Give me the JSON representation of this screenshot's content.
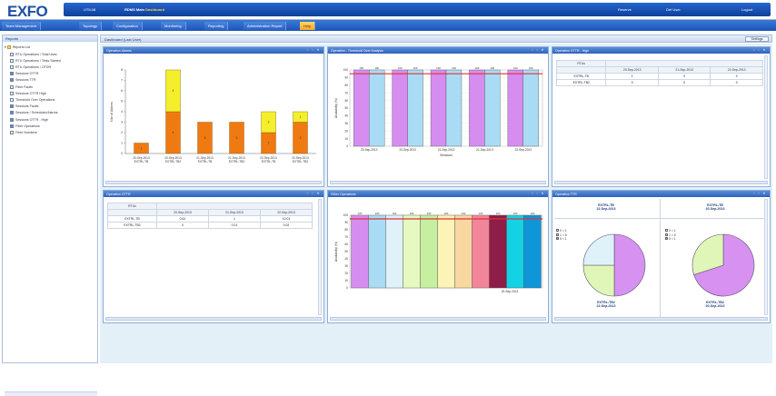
{
  "header": {
    "logo": "EXFO",
    "site": "UTIL08",
    "app_name": "RDMS Main",
    "app_sub": "Dashboard",
    "right_a": "Reserve",
    "right_b": "Def User",
    "logout": "Logout"
  },
  "tabs": [
    {
      "label": "Team Management",
      "active": false
    },
    {
      "label": "Topology",
      "active": false
    },
    {
      "label": "Configuration",
      "active": false
    },
    {
      "label": "Monitoring",
      "active": false
    },
    {
      "label": "Reporting",
      "active": false
    },
    {
      "label": "Administration Report",
      "active": false
    },
    {
      "label": "Help",
      "active": true
    }
  ],
  "left_panel": {
    "title": "Reports",
    "root": "Reports List",
    "items": [
      {
        "label": "RTU Operations / Total Uses",
        "checked": false
      },
      {
        "label": "RTU Operations / Tests Started",
        "checked": false
      },
      {
        "label": "RTU Operations / OTDR",
        "checked": false
      },
      {
        "label": "Sessions OTTR",
        "checked": true
      },
      {
        "label": "Sessions TTR",
        "checked": true
      },
      {
        "label": "Fiber Faults",
        "checked": false
      },
      {
        "label": "Sessions OTTR High",
        "checked": false
      },
      {
        "label": "Threshold Over Operations",
        "checked": false
      },
      {
        "label": "Sessions Faults",
        "checked": true
      },
      {
        "label": "Sessions / Scheduled Alarms",
        "checked": true
      },
      {
        "label": "Sessions OTTR - High",
        "checked": true
      },
      {
        "label": "Fiber Operations",
        "checked": true
      },
      {
        "label": "Fiber Numbers",
        "checked": false
      }
    ]
  },
  "dashboard": {
    "title": "Dashboard (Last User)",
    "settings_label": "Settings"
  },
  "panels": {
    "p1": {
      "title": "Operation Alarms"
    },
    "p2": {
      "title": "Operation - Threshold Over Analysis"
    },
    "p3": {
      "title": "Operation OTTR - High"
    },
    "p4": {
      "title": "Operation OTTR"
    },
    "p5": {
      "title": "Other Operations"
    },
    "p6": {
      "title": "Operation TTR"
    }
  },
  "table_ottr_high": {
    "col_label": "RTUs",
    "headers": [
      "",
      "20-Sep-2013",
      "21-Sep-2013",
      "22-Sep-2013"
    ],
    "rows": [
      [
        "EXTRL-TB",
        "1",
        "0",
        "0"
      ],
      [
        "EXTRL-TB2",
        "0",
        "0",
        "0"
      ]
    ]
  },
  "table_ottr": {
    "col_label": "RTUs",
    "headers": [
      "",
      "20-Sep-2013",
      "21-Sep-2013",
      "22-Sep-2013"
    ],
    "rows": [
      [
        "EXTRL-TB",
        "0.61",
        "1",
        "10.01"
      ],
      [
        "EXTRL-TB2",
        "0",
        "0.01",
        "0.02"
      ]
    ]
  },
  "pies": [
    {
      "top_label_1": "EXTRL-TB",
      "top_label_2": "22-Sep-2013",
      "bottom_label_1": "EXTRL-TB2",
      "bottom_label_2": "22-Sep-2013"
    },
    {
      "top_label_1": "EXTRL-TB",
      "top_label_2": "20-Sep-2013",
      "bottom_label_1": "EXTRL-TB2",
      "bottom_label_2": "20-Sep-2013"
    }
  ],
  "pie_legend": [
    "0 < 1",
    "1 < 5",
    "5 < 1"
  ],
  "colors": {
    "accent": "#2d62bd",
    "tab_active": "#f4a52a",
    "bar_orange": "#f07a12",
    "bar_yellow": "#f4ef2c",
    "threshold_line": "#e0303a",
    "bar_purple": "#d68df0",
    "bar_blue": "#a9dcf4",
    "pie_purple": "#d791f0",
    "pie_green": "#dff6b8",
    "pie_lightblue": "#dff2fa"
  },
  "chart_data": [
    {
      "type": "bar",
      "name": "Operation Alarms",
      "categories": [
        "20-Sep-2013 EXTRL-TB",
        "20-Sep-2013 EXTRL-TB2",
        "21-Sep-2013 EXTRL-TB",
        "21-Sep-2013 EXTRL-TB2",
        "22-Sep-2013 EXTRL-TB",
        "22-Sep-2013 EXTRL-TB2"
      ],
      "series": [
        {
          "values": [
            1,
            4,
            3,
            3,
            2,
            3
          ],
          "color": "#f07a12"
        },
        {
          "values": [
            0,
            4,
            0,
            0,
            2,
            1
          ],
          "color": "#f4ef2c"
        }
      ],
      "ylabel": "Nbr of Alarms",
      "ylim": [
        0,
        8
      ]
    },
    {
      "type": "bar",
      "name": "Operation - Threshold Over Analysis",
      "categories": [
        "20-Sep-2013",
        "20-Sep-2013",
        "21-Sep-2013",
        "21-Sep-2013",
        "22-Sep-2013"
      ],
      "series": [
        {
          "values": [
            100,
            100,
            100,
            100,
            100
          ],
          "color": "#d68df0"
        },
        {
          "values": [
            100,
            100,
            100,
            100,
            100
          ],
          "color": "#a9dcf4"
        }
      ],
      "threshold": 95,
      "ylabel": "Availability (%)",
      "xlabel": "Sessions",
      "ylim": [
        0,
        100
      ]
    },
    {
      "type": "bar",
      "name": "Other Operations",
      "categories": [
        "20-Sep-2013"
      ],
      "series": [
        {
          "values": [
            100
          ],
          "color": "#d68df0"
        },
        {
          "values": [
            100
          ],
          "color": "#a9dcf4"
        },
        {
          "values": [
            100
          ],
          "color": "#dff2fa"
        },
        {
          "values": [
            100
          ],
          "color": "#e6f9c0"
        },
        {
          "values": [
            100
          ],
          "color": "#c6f0a0"
        },
        {
          "values": [
            100
          ],
          "color": "#fbf4b6"
        },
        {
          "values": [
            100
          ],
          "color": "#f8d7a0"
        },
        {
          "values": [
            100
          ],
          "color": "#f2859a"
        },
        {
          "values": [
            100
          ],
          "color": "#8e1d48"
        },
        {
          "values": [
            100
          ],
          "color": "#12d2e4"
        },
        {
          "values": [
            100
          ],
          "color": "#0f96d9"
        }
      ],
      "threshold": 95,
      "ylabel": "Availability (%)",
      "ylim": [
        0,
        100
      ]
    },
    {
      "type": "pie",
      "name": "Operation TTR - EXTRL-TB 22-Sep-2013",
      "values": [
        50,
        25,
        25
      ],
      "colors": [
        "#d791f0",
        "#dff6b8",
        "#dff2fa"
      ]
    },
    {
      "type": "pie",
      "name": "Operation TTR - EXTRL-TB 20-Sep-2013",
      "values": [
        70,
        30
      ],
      "colors": [
        "#d791f0",
        "#dff6b8"
      ]
    }
  ]
}
